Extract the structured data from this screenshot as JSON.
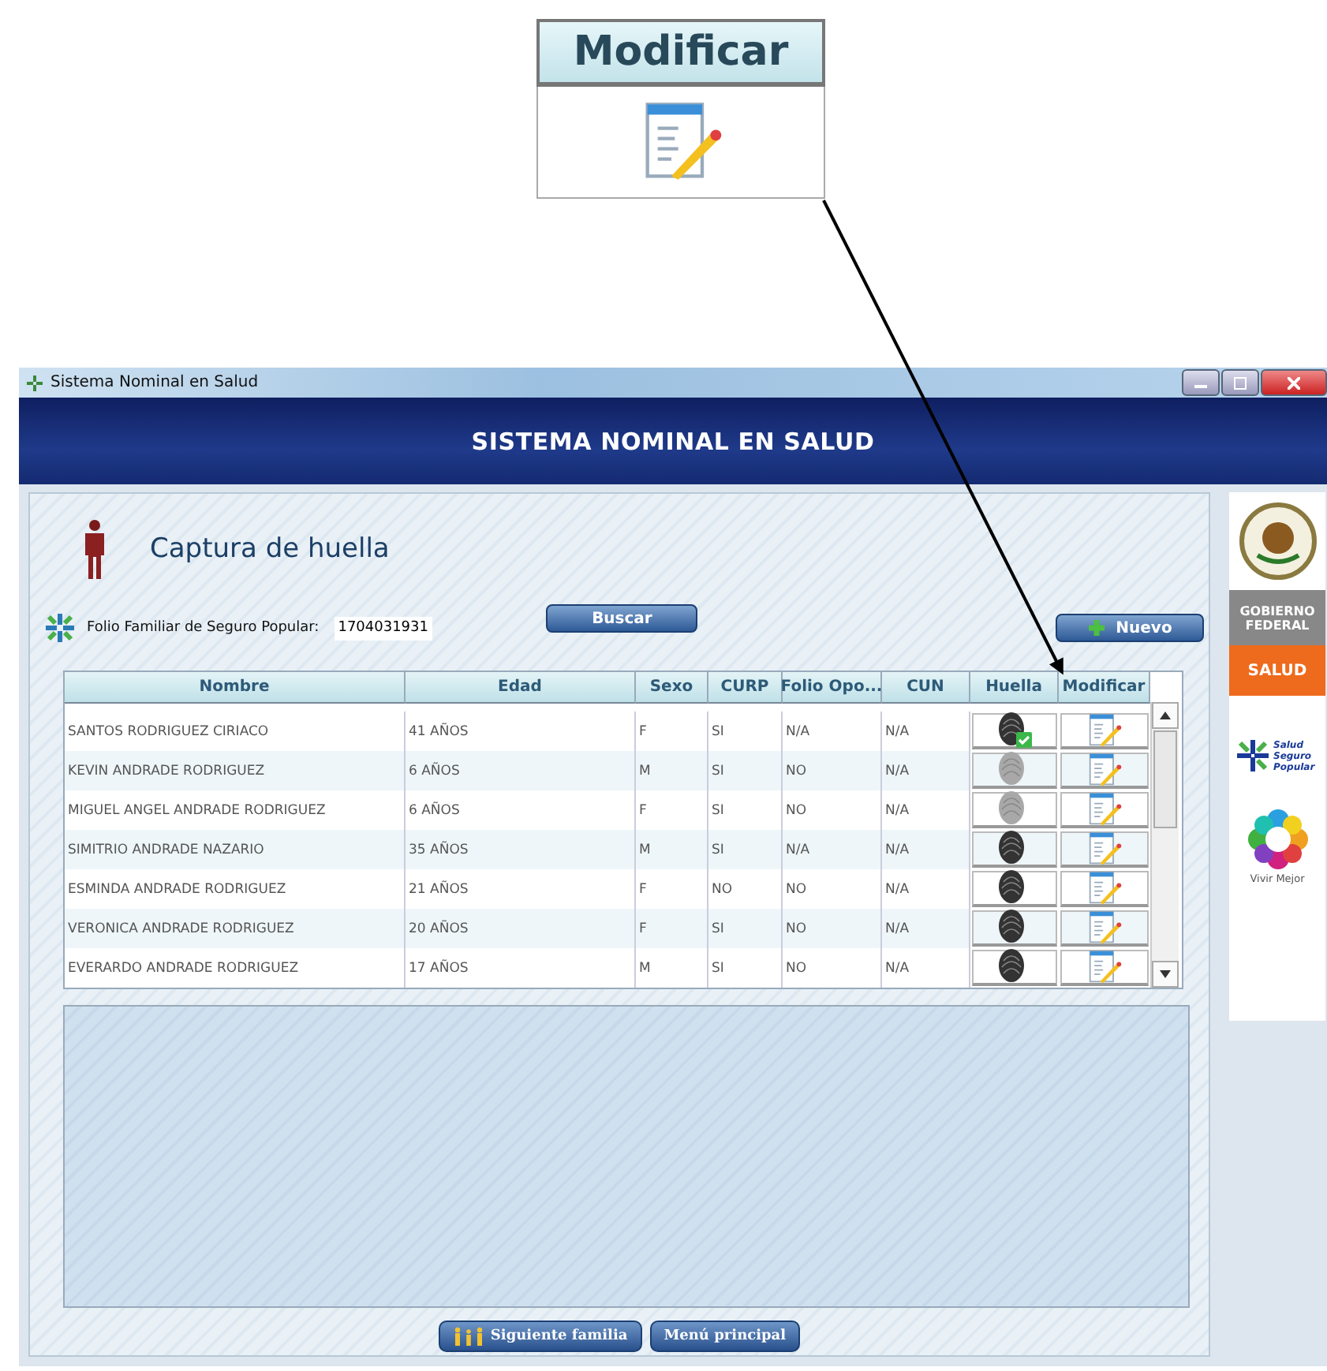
{
  "callout": {
    "header": "Modificar"
  },
  "window": {
    "title": "Sistema Nominal en Salud"
  },
  "banner": {
    "title": "SISTEMA NOMINAL EN SALUD"
  },
  "page": {
    "title": "Captura de huella"
  },
  "folio": {
    "label": "Folio Familiar de Seguro Popular:",
    "value": "1704031931"
  },
  "buttons": {
    "search": "Buscar",
    "new": "Nuevo"
  },
  "table": {
    "columns": [
      "Nombre",
      "Edad",
      "Sexo",
      "CURP",
      "Folio Opo...",
      "CUN",
      "Huella",
      "Modificar"
    ],
    "rows": [
      {
        "name": "SANTOS RODRIGUEZ CIRIACO",
        "age": "41 AÑOS",
        "sex": "F",
        "curp": "SI",
        "folio": "N/A",
        "cun": "N/A",
        "fingerprint": {
          "kind": "dark",
          "verified": true
        }
      },
      {
        "name": "KEVIN ANDRADE RODRIGUEZ",
        "age": "6 AÑOS",
        "sex": "M",
        "curp": "SI",
        "folio": "NO",
        "cun": "N/A",
        "fingerprint": {
          "kind": "faint",
          "verified": false
        }
      },
      {
        "name": "MIGUEL ANGEL ANDRADE RODRIGUEZ",
        "age": "6 AÑOS",
        "sex": "F",
        "curp": "SI",
        "folio": "NO",
        "cun": "N/A",
        "fingerprint": {
          "kind": "faint",
          "verified": false
        }
      },
      {
        "name": "SIMITRIO ANDRADE NAZARIO",
        "age": "35 AÑOS",
        "sex": "M",
        "curp": "SI",
        "folio": "N/A",
        "cun": "N/A",
        "fingerprint": {
          "kind": "dark",
          "verified": false
        }
      },
      {
        "name": "ESMINDA ANDRADE RODRIGUEZ",
        "age": "21 AÑOS",
        "sex": "F",
        "curp": "NO",
        "folio": "NO",
        "cun": "N/A",
        "fingerprint": {
          "kind": "dark",
          "verified": false
        }
      },
      {
        "name": "VERONICA ANDRADE RODRIGUEZ",
        "age": "20 AÑOS",
        "sex": "F",
        "curp": "SI",
        "folio": "NO",
        "cun": "N/A",
        "fingerprint": {
          "kind": "dark",
          "verified": false
        }
      },
      {
        "name": "EVERARDO ANDRADE RODRIGUEZ",
        "age": "17 AÑOS",
        "sex": "M",
        "curp": "SI",
        "folio": "NO",
        "cun": "N/A",
        "fingerprint": {
          "kind": "dark",
          "verified": false
        }
      }
    ]
  },
  "footer_buttons": [
    {
      "label": "Siguiente familia",
      "kind": "family"
    },
    {
      "label": "Menú principal",
      "kind": "menu"
    }
  ],
  "sidebar": {
    "government": [
      "GOBIERNO",
      "FEDERAL"
    ],
    "ministry": "SALUD",
    "program": [
      "Salud",
      "Seguro",
      "Popular"
    ],
    "slogan": "Vivir Mejor"
  }
}
